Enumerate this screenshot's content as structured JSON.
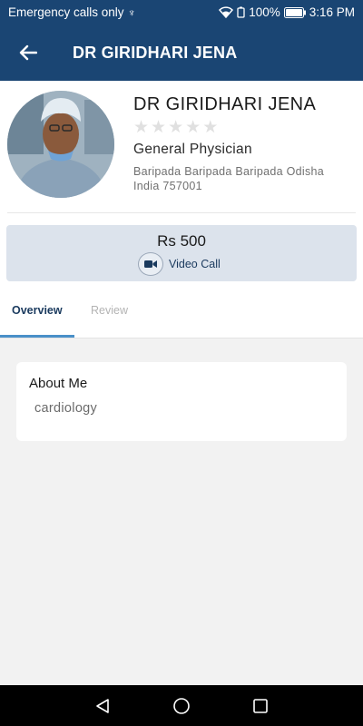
{
  "status_bar": {
    "left_text": "Emergency calls only",
    "battery": "100%",
    "time": "3:16 PM"
  },
  "app_bar": {
    "title": "DR GIRIDHARI JENA",
    "back_icon": "arrow-back-icon"
  },
  "doctor": {
    "name": "DR GIRIDHARI JENA",
    "rating": 0,
    "rating_max": 5,
    "specialty": "General Physician",
    "address": "Baripada Baripada Baripada Odisha India 757001"
  },
  "fee_card": {
    "fee": "Rs 500",
    "call_label": "Video Call",
    "call_icon": "video-camera-icon"
  },
  "tabs": [
    {
      "label": "Overview",
      "active": true
    },
    {
      "label": "Review",
      "active": false
    }
  ],
  "about": {
    "title": "About Me",
    "text": "cardiology"
  },
  "colors": {
    "primary": "#1a4573",
    "tab_indicator": "#4a90c8",
    "fee_card_bg": "#dce3ec",
    "star_empty": "#e0e0e0"
  }
}
